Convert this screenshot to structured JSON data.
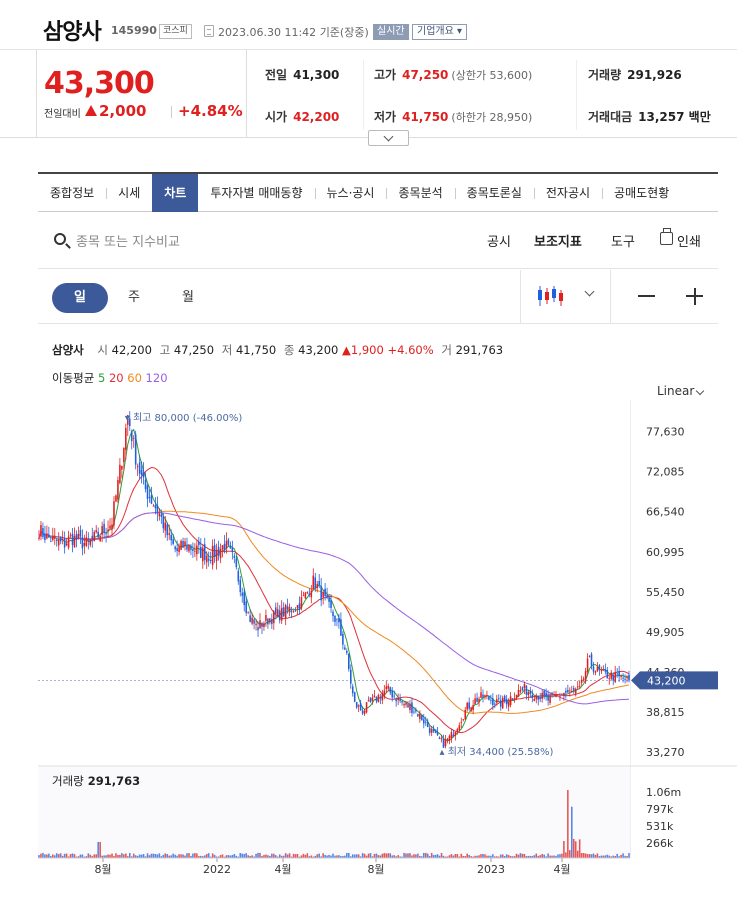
{
  "header": {
    "stock_name": "삼양사",
    "stock_code": "145990",
    "market": "코스피",
    "datetime": "2023.06.30 11:42",
    "basis": "기준(장중)",
    "realtime_badge": "실시간",
    "company_overview": "기업개요"
  },
  "summary": {
    "price": "43,300",
    "change_label": "전일대비",
    "change": "2,000",
    "change_pct": "+4.84%",
    "prev_close_label": "전일",
    "prev_close": "41,300",
    "high_label": "고가",
    "high": "47,250",
    "upper_limit": "(상한가 53,600)",
    "volume_label": "거래량",
    "volume": "291,926",
    "open_label": "시가",
    "open": "42,200",
    "low_label": "저가",
    "low": "41,750",
    "lower_limit": "(하한가 28,950)",
    "value_label": "거래대금",
    "value": "13,257 백만"
  },
  "tabs": [
    "종합정보",
    "시세",
    "차트",
    "투자자별 매매동향",
    "뉴스·공시",
    "종목분석",
    "종목토론실",
    "전자공시",
    "공매도현황"
  ],
  "active_tab": "차트",
  "toolbar": {
    "search_placeholder": "종목 또는 지수비교",
    "disclosure": "공시",
    "indicators": "보조지표",
    "tools": "도구",
    "print": "인쇄"
  },
  "period": {
    "day": "일",
    "week": "주",
    "month": "월",
    "active": "일"
  },
  "legend": {
    "name": "삼양사",
    "open_k": "시",
    "open": "42,200",
    "high_k": "고",
    "high": "47,250",
    "low_k": "저",
    "low": "41,750",
    "close_k": "종",
    "close": "43,200",
    "change": "1,900",
    "change_pct": "+4.60%",
    "vol_k": "거",
    "vol": "291,763",
    "ma_label": "이동평균",
    "ma": [
      {
        "period": "5",
        "color": "#2e9e3a"
      },
      {
        "period": "20",
        "color": "#e0303a"
      },
      {
        "period": "60",
        "color": "#f08a1e"
      },
      {
        "period": "120",
        "color": "#9b5de5"
      }
    ]
  },
  "scale_label": "Linear",
  "volume_legend": {
    "label": "거래량",
    "value": "291,763"
  },
  "colors": {
    "up": "#e01f1f",
    "down": "#1f5fe0",
    "accent": "#3c5a9a"
  },
  "chart_data": {
    "type": "candlestick",
    "y_axis": {
      "ticks": [
        "77,630",
        "72,085",
        "66,540",
        "60,995",
        "55,450",
        "49,905",
        "44,360",
        "38,815",
        "33,270"
      ],
      "range": [
        31500,
        82000
      ]
    },
    "x_axis": {
      "ticks": [
        "8월",
        "2022",
        "4월",
        "8월",
        "2023",
        "4월"
      ]
    },
    "current_price_tag": "43,200",
    "max_annotation": "최고 80,000 (-46.00%)",
    "min_annotation": "최저 34,400 (25.58%)",
    "close_series_approx": [
      64000,
      63000,
      62500,
      62000,
      63000,
      62500,
      62000,
      63000,
      64000,
      65000,
      72000,
      80000,
      74000,
      70000,
      68000,
      66000,
      63000,
      61000,
      62000,
      61500,
      61000,
      60500,
      61000,
      62000,
      60000,
      56000,
      52000,
      50500,
      51500,
      52000,
      52500,
      53000,
      53500,
      55000,
      57000,
      55000,
      53000,
      51000,
      47000,
      40000,
      39000,
      40000,
      41000,
      42000,
      41000,
      40000,
      39500,
      38500,
      37000,
      35500,
      34400,
      35500,
      37500,
      39500,
      40500,
      41000,
      40500,
      40000,
      40500,
      41500,
      42000,
      41500,
      41000,
      40500,
      41000,
      41500,
      41500,
      42000,
      46000,
      44500,
      44000,
      43800,
      43500,
      43200
    ],
    "volume_axis": {
      "ticks": [
        "1.06m",
        "797k",
        "531k",
        "266k"
      ],
      "max": 1060000
    }
  }
}
